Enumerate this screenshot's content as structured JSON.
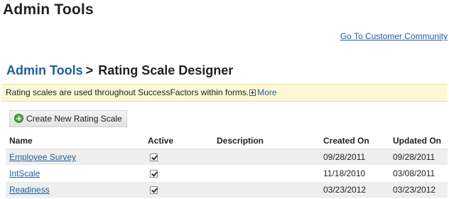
{
  "header": {
    "title": "Admin Tools",
    "community_link": "Go To Customer Community"
  },
  "breadcrumb": {
    "parent": "Admin Tools",
    "separator": ">",
    "current": "Rating Scale Designer"
  },
  "info_bar": {
    "text": "Rating scales are used throughout SuccessFactors within forms.",
    "more_label": "More"
  },
  "toolbar": {
    "create_label": "Create New Rating Scale"
  },
  "table": {
    "columns": [
      "Name",
      "Active",
      "Description",
      "Created On",
      "Updated On"
    ],
    "rows": [
      {
        "name": "Employee Survey",
        "active": true,
        "description": "",
        "created": "09/28/2011",
        "updated": "09/28/2011"
      },
      {
        "name": "IntScale",
        "active": true,
        "description": "",
        "created": "11/18/2010",
        "updated": "03/08/2011"
      },
      {
        "name": "Readiness",
        "active": true,
        "description": "",
        "created": "03/23/2012",
        "updated": "03/23/2012"
      }
    ]
  },
  "icons": {
    "expand": "plus-box-icon",
    "create": "green-plus-circle-icon",
    "checkbox": "checkbox-checked-icon"
  },
  "colors": {
    "link": "#1f5e9a",
    "info_bar_bg": "#fbf9d3",
    "row_alt_bg": "#eeeeee",
    "create_icon": "#45a83c"
  }
}
